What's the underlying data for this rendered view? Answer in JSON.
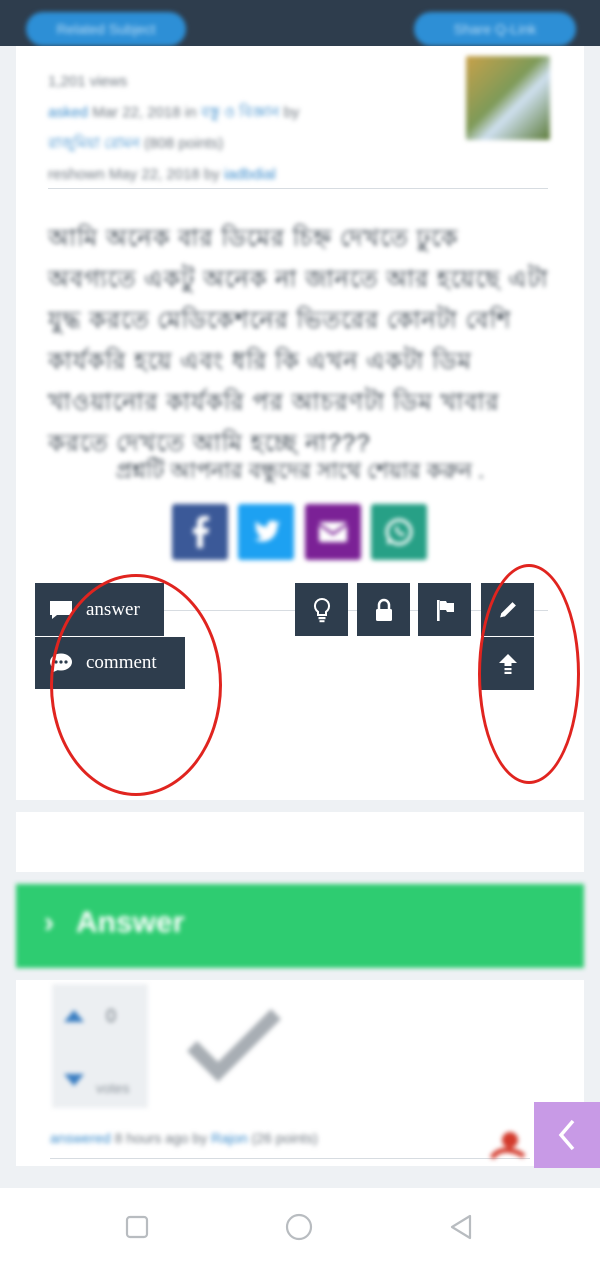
{
  "header": {
    "left_button": "Related Subject",
    "right_button": "Share Q-Link"
  },
  "question": {
    "views": "1,201 views",
    "asked_label": "asked",
    "asked_date": "Mar 22, 2018 in",
    "category": "বস্তু ও বিজ্ঞান",
    "by_label": "by",
    "author": "রাজুমিয়া রোমন",
    "author_points": "(808 points)",
    "recategorized": "reshown May 22, 2018 by",
    "recategorized_by": "iadbdial",
    "body": "আমি অনেক বার ডিমের চিহ্ন দেখতে ঢুকে অবগ্যতে একটু অনেক না জানতে আর হয়েছে এটা যুদ্ধ করতে মেডিকেশনের ভিতরের কোনটা বেশি কার্যকরি হয়ে এবং ধরি কি এখন একটা ডিম খাওয়ানোর কার্যকরি পর আচরণটা ডিম খাবার করতে দেখতে আমি হচ্ছে না???",
    "share_prompt": "প্রশ্নটি আপনার বন্ধুদের সাথে শেয়ার করুন ."
  },
  "actions": {
    "answer_label": "answer",
    "comment_label": "comment",
    "icon_buttons": [
      "lightbulb-icon",
      "lock-icon",
      "flag-icon",
      "pencil-icon",
      "upload-icon"
    ]
  },
  "answers_section": {
    "title": "Answer",
    "vote_count": "0",
    "votes_label": "votes",
    "answered_label": "answered",
    "answered_time": "8 hours ago by",
    "answered_by": "Rajon",
    "answered_points": "(26 points)"
  },
  "colors": {
    "topbar": "#2e3d4d",
    "accent": "#2ecc71",
    "link": "#3a8bcb",
    "annotation": "#e0241f"
  }
}
